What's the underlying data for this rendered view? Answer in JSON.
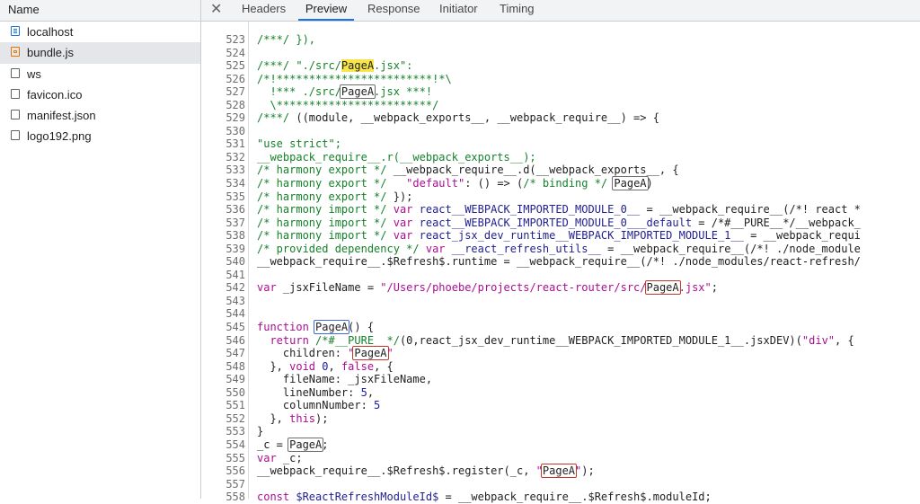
{
  "left_panel": {
    "header": "Name",
    "requests": [
      {
        "name": "localhost",
        "icon": "document-icon"
      },
      {
        "name": "bundle.js",
        "icon": "script-icon"
      },
      {
        "name": "ws",
        "icon": "file-icon"
      },
      {
        "name": "favicon.ico",
        "icon": "file-icon"
      },
      {
        "name": "manifest.json",
        "icon": "file-icon"
      },
      {
        "name": "logo192.png",
        "icon": "file-icon"
      }
    ]
  },
  "tabs": {
    "close": "✕",
    "items": [
      "Headers",
      "Preview",
      "Response",
      "Initiator",
      "Timing"
    ],
    "active": "Preview"
  },
  "code": {
    "lines": [
      {
        "n": "523",
        "s": [
          [
            "c",
            "/***/ }),"
          ]
        ]
      },
      {
        "n": "524",
        "s": []
      },
      {
        "n": "525",
        "s": [
          [
            "c",
            "/***/ \"./src/"
          ],
          [
            "hl",
            "PageA"
          ],
          [
            "c",
            ".jsx\":"
          ]
        ]
      },
      {
        "n": "526",
        "s": [
          [
            "c",
            "/*!************************!*\\"
          ]
        ]
      },
      {
        "n": "527",
        "s": [
          [
            "c",
            "  !*** ./src/"
          ],
          [
            "bx",
            "PageA"
          ],
          [
            "c",
            ".jsx ***!"
          ]
        ]
      },
      {
        "n": "528",
        "s": [
          [
            "c",
            "  \\************************/"
          ]
        ]
      },
      {
        "n": "529",
        "s": [
          [
            "c",
            "/***/ "
          ],
          [
            "p",
            "((module, __webpack_exports__, __webpack_require__) => {"
          ]
        ]
      },
      {
        "n": "530",
        "s": []
      },
      {
        "n": "531",
        "s": [
          [
            "c",
            "\"use strict\";"
          ]
        ]
      },
      {
        "n": "532",
        "s": [
          [
            "c",
            "__webpack_require__.r(__webpack_exports__);"
          ]
        ]
      },
      {
        "n": "533",
        "s": [
          [
            "c",
            "/* harmony export */ "
          ],
          [
            "p",
            "__webpack_require__.d(__webpack_exports__, {"
          ]
        ]
      },
      {
        "n": "534",
        "s": [
          [
            "c",
            "/* harmony export */   "
          ],
          [
            "k",
            "\"default\""
          ],
          [
            "p",
            ": () => ("
          ],
          [
            "c",
            "/* binding */ "
          ],
          [
            "bx",
            "PageA"
          ],
          [
            "p",
            ")"
          ]
        ]
      },
      {
        "n": "535",
        "s": [
          [
            "c",
            "/* harmony export */ "
          ],
          [
            "p",
            "});"
          ]
        ]
      },
      {
        "n": "536",
        "s": [
          [
            "c",
            "/* harmony import */ "
          ],
          [
            "k",
            "var "
          ],
          [
            "v",
            "react__WEBPACK_IMPORTED_MODULE_0__"
          ],
          [
            "p",
            " = __webpack_require__(/*! react *"
          ]
        ]
      },
      {
        "n": "537",
        "s": [
          [
            "c",
            "/* harmony import */ "
          ],
          [
            "k",
            "var "
          ],
          [
            "v",
            "react__WEBPACK_IMPORTED_MODULE_0___default"
          ],
          [
            "p",
            " = /*#__PURE__*/__webpack_"
          ]
        ]
      },
      {
        "n": "538",
        "s": [
          [
            "c",
            "/* harmony import */ "
          ],
          [
            "k",
            "var "
          ],
          [
            "v",
            "react_jsx_dev_runtime__WEBPACK_IMPORTED_MODULE_1__"
          ],
          [
            "p",
            " = __webpack_requi"
          ]
        ]
      },
      {
        "n": "539",
        "s": [
          [
            "c",
            "/* provided dependency */ "
          ],
          [
            "k",
            "var "
          ],
          [
            "v",
            "__react_refresh_utils__"
          ],
          [
            "p",
            " = __webpack_require__(/*! ./node_module"
          ]
        ]
      },
      {
        "n": "540",
        "s": [
          [
            "p",
            "__webpack_require__.$Refresh$.runtime = __webpack_require__(/*! ./node_modules/react-refresh/"
          ]
        ]
      },
      {
        "n": "541",
        "s": []
      },
      {
        "n": "542",
        "s": [
          [
            "k",
            "var "
          ],
          [
            "p",
            "_jsxFileName = "
          ],
          [
            "k",
            "\"/Users/phoebe/projects/react-router/src/"
          ],
          [
            "rb",
            "PageA"
          ],
          [
            "k",
            ".jsx\""
          ],
          [
            "p",
            ";"
          ]
        ]
      },
      {
        "n": "543",
        "s": []
      },
      {
        "n": "544",
        "s": []
      },
      {
        "n": "545",
        "s": [
          [
            "k",
            "function "
          ],
          [
            "bb",
            "PageA"
          ],
          [
            "p",
            "() {"
          ]
        ]
      },
      {
        "n": "546",
        "s": [
          [
            "k",
            "  return "
          ],
          [
            "c",
            "/*#__PURE__*/"
          ],
          [
            "p",
            "(0,react_jsx_dev_runtime__WEBPACK_IMPORTED_MODULE_1__.jsxDEV)("
          ],
          [
            "k",
            "\"div\""
          ],
          [
            "p",
            ", {"
          ]
        ]
      },
      {
        "n": "547",
        "s": [
          [
            "p",
            "    children: "
          ],
          [
            "k",
            "\""
          ],
          [
            "rb",
            "PageA"
          ],
          [
            "k",
            "\""
          ]
        ]
      },
      {
        "n": "548",
        "s": [
          [
            "p",
            "  }, "
          ],
          [
            "k",
            "void "
          ],
          [
            "m",
            "0"
          ],
          [
            "p",
            ", "
          ],
          [
            "k",
            "false"
          ],
          [
            "p",
            ", {"
          ]
        ]
      },
      {
        "n": "549",
        "s": [
          [
            "p",
            "    fileName: _jsxFileName,"
          ]
        ]
      },
      {
        "n": "550",
        "s": [
          [
            "p",
            "    lineNumber: "
          ],
          [
            "m",
            "5"
          ],
          [
            "p",
            ","
          ]
        ]
      },
      {
        "n": "551",
        "s": [
          [
            "p",
            "    columnNumber: "
          ],
          [
            "m",
            "5"
          ]
        ]
      },
      {
        "n": "552",
        "s": [
          [
            "p",
            "  }, "
          ],
          [
            "k",
            "this"
          ],
          [
            "p",
            ");"
          ]
        ]
      },
      {
        "n": "553",
        "s": [
          [
            "p",
            "}"
          ]
        ]
      },
      {
        "n": "554",
        "s": [
          [
            "p",
            "_c = "
          ],
          [
            "bx",
            "PageA"
          ],
          [
            "p",
            ";"
          ]
        ]
      },
      {
        "n": "555",
        "s": [
          [
            "k",
            "var "
          ],
          [
            "p",
            "_c;"
          ]
        ]
      },
      {
        "n": "556",
        "s": [
          [
            "p",
            "__webpack_require__.$Refresh$.register(_c, "
          ],
          [
            "k",
            "\""
          ],
          [
            "rb",
            "PageA"
          ],
          [
            "k",
            "\""
          ],
          [
            "p",
            ");"
          ]
        ]
      },
      {
        "n": "557",
        "s": []
      },
      {
        "n": "558",
        "s": [
          [
            "k",
            "const "
          ],
          [
            "v",
            "$ReactRefreshModuleId$"
          ],
          [
            "p",
            " = __webpack_require__.$Refresh$.moduleId;"
          ]
        ]
      }
    ]
  }
}
